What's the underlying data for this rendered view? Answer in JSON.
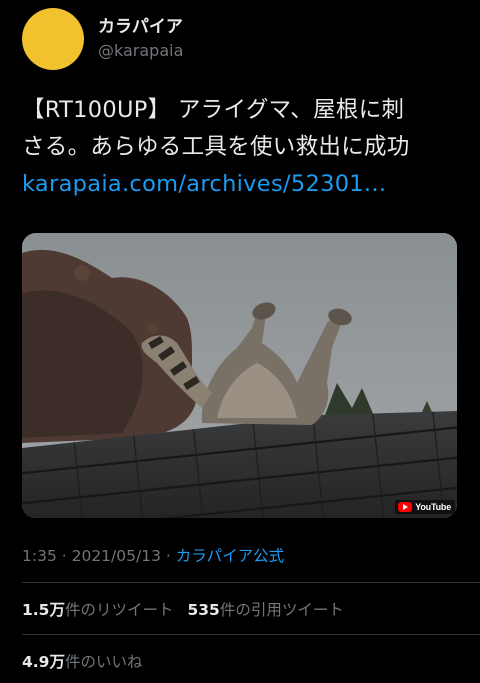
{
  "author": {
    "display_name": "カラパイア",
    "handle": "@karapaia",
    "avatar_color": "#f2c12e"
  },
  "tweet": {
    "text_line1": "【RT100UP】 アライグマ、屋根に刺",
    "text_line2": "さる。あらゆる工具を使い救出に成功",
    "link": "karapaia.com/archives/52301..."
  },
  "media": {
    "badge_text": "YouTube",
    "badge_icon": "youtube-logo-icon"
  },
  "meta": {
    "time": "1:35",
    "separator1": " · ",
    "date": "2021/05/13",
    "separator2": " · ",
    "source": "カラパイア公式"
  },
  "stats": {
    "retweets_count": "1.5万",
    "retweets_label": "件のリツイート",
    "quotes_count": "535",
    "quotes_label": "件の引用ツイート",
    "likes_count": "4.9万",
    "likes_label": "件のいいね"
  },
  "colors": {
    "background": "#000000",
    "text": "#e7e9ea",
    "secondary": "#71767b",
    "link": "#1d9bf0",
    "divider": "#2f3336"
  }
}
